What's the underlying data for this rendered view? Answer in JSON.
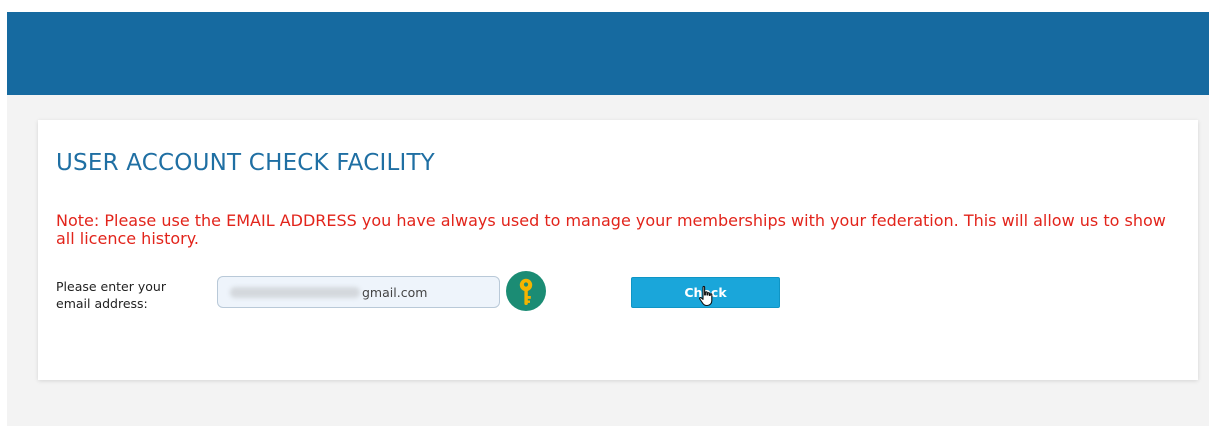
{
  "header": {
    "color": "#166aa0"
  },
  "card": {
    "title": "USER ACCOUNT CHECK FACILITY",
    "note": "Note: Please use the EMAIL ADDRESS you have always used to manage your memberships with your federation. This will allow us to show all licence history.",
    "email_label": "Please enter your email address:",
    "email_value_visible": "gmail.com",
    "check_label": "Check"
  },
  "colors": {
    "title": "#1f6fa3",
    "note": "#e2241b",
    "button": "#1aa6da",
    "key_badge": "#1b8c74",
    "key": "#f4b400"
  },
  "icons": {
    "key": "key-icon",
    "cursor": "hand-pointer-cursor"
  }
}
